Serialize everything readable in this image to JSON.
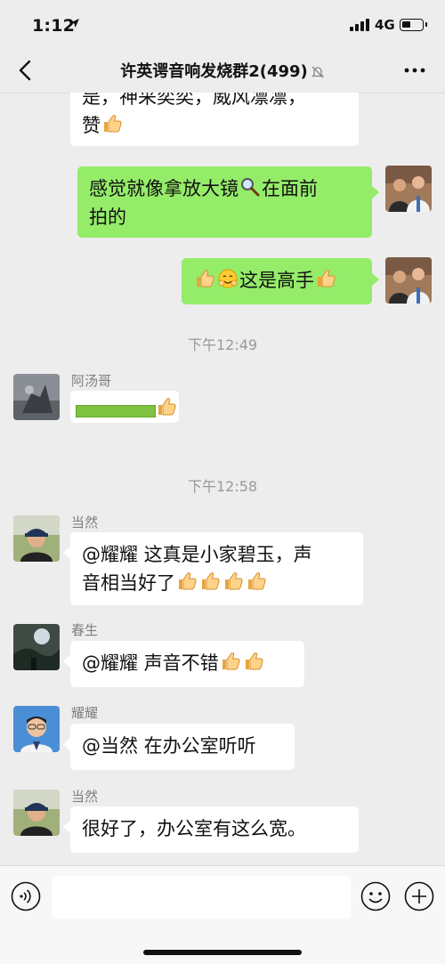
{
  "status_bar": {
    "time": "1:12",
    "network": "4G",
    "battery_percent": 30
  },
  "nav": {
    "title": "许英谔音响发烧群2(499)",
    "muted": true
  },
  "messages": [
    {
      "side": "left",
      "text_line1": "是，神采奕奕，威风凛凛，",
      "text_line2": "赞",
      "emoji": [
        "thumbs-up"
      ]
    },
    {
      "side": "right",
      "text_line1": "感觉就像拿放大镜",
      "emoji_inline": "magnifier",
      "text_line1b": "在面前",
      "text_line2": "拍的"
    },
    {
      "side": "right",
      "emoji": [
        "thumbs-up",
        "hug-face"
      ],
      "text": "这是高手",
      "emoji_after": [
        "thumbs-up"
      ]
    },
    {
      "side": "left",
      "sender": "阿汤哥",
      "emoji": [
        "green-progress-bar",
        "thumbs-up"
      ]
    },
    {
      "side": "left",
      "sender": "当然",
      "text_line1": "@耀耀 这真是小家碧玉，声",
      "text_line2": "音相当好了",
      "emoji": [
        "thumbs-up",
        "thumbs-up",
        "thumbs-up",
        "thumbs-up"
      ]
    },
    {
      "side": "left",
      "sender": "春生",
      "text": "@耀耀 声音不错",
      "emoji": [
        "thumbs-up",
        "thumbs-up"
      ]
    },
    {
      "side": "left",
      "sender": "耀耀",
      "text": "@当然 在办公室听听"
    },
    {
      "side": "left",
      "sender": "当然",
      "text": "很好了，办公室有这么宽。"
    }
  ],
  "timestamps": [
    "下午12:49",
    "下午12:58"
  ],
  "input_bar": {
    "placeholder": ""
  },
  "colors": {
    "background": "#ededed",
    "self_bubble": "#95ec69",
    "other_bubble": "#ffffff",
    "timestamp_text": "#999999",
    "sender_text": "#7f7f7f"
  }
}
